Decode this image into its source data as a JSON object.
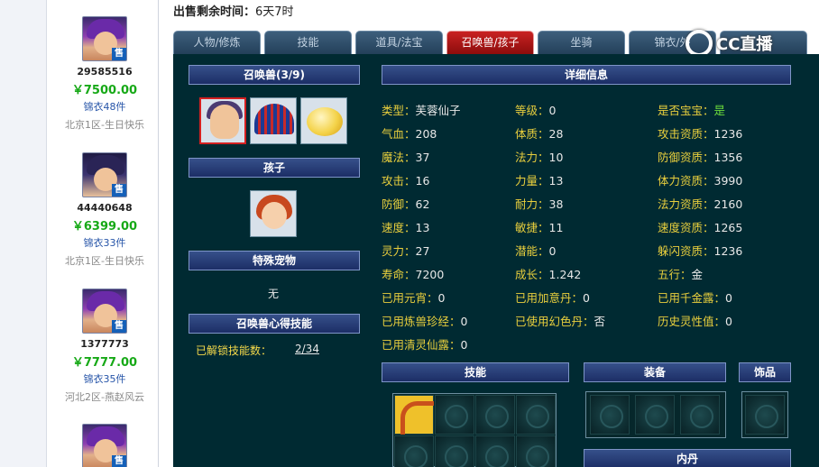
{
  "sidebar": {
    "listings": [
      {
        "id": "29585516",
        "price": "￥7500.00",
        "count": "锦衣48件",
        "server": "北京1区-生日快乐",
        "badge": "售"
      },
      {
        "id": "44440648",
        "price": "￥6399.00",
        "count": "锦衣33件",
        "server": "北京1区-生日快乐",
        "badge": "售"
      },
      {
        "id": "1377773",
        "price": "￥7777.00",
        "count": "锦衣35件",
        "server": "河北2区-燕赵风云",
        "badge": "售"
      },
      {
        "id": "",
        "price": "",
        "count": "",
        "server": "",
        "badge": "售"
      }
    ]
  },
  "header": {
    "countdown_label": "出售剩余时间：",
    "countdown_value": "6天7时"
  },
  "tabs": [
    {
      "label": "人物/修炼",
      "active": false
    },
    {
      "label": "技能",
      "active": false
    },
    {
      "label": "道具/法宝",
      "active": false
    },
    {
      "label": "召唤兽/孩子",
      "active": true
    },
    {
      "label": "坐骑",
      "active": false
    },
    {
      "label": "锦衣/外",
      "active": false
    },
    {
      "label": "",
      "active": false
    }
  ],
  "watermark": "CC直播",
  "left_panel": {
    "summon_title": "召唤兽(3/9)",
    "child_title": "孩子",
    "special_pet_title": "特殊宠物",
    "special_pet_value": "无",
    "skill_title": "召唤兽心得技能",
    "unlocked_label": "已解锁技能数：",
    "unlocked_value": "2/34"
  },
  "detail_title": "详细信息",
  "attributes": {
    "col1": [
      {
        "k": "类型：",
        "v": "芙蓉仙子"
      },
      {
        "k": "气血：",
        "v": "208"
      },
      {
        "k": "魔法：",
        "v": "37"
      },
      {
        "k": "攻击：",
        "v": "16"
      },
      {
        "k": "防御：",
        "v": "62"
      },
      {
        "k": "速度：",
        "v": "13"
      },
      {
        "k": "灵力：",
        "v": "27"
      },
      {
        "k": "寿命：",
        "v": "7200"
      },
      {
        "k": "已用元宵：",
        "v": "0"
      },
      {
        "k": "已用炼兽珍经：",
        "v": "0"
      },
      {
        "k": "已用清灵仙露：",
        "v": "0"
      }
    ],
    "col2": [
      {
        "k": "等级：",
        "v": "0"
      },
      {
        "k": "体质：",
        "v": "28"
      },
      {
        "k": "法力：",
        "v": "10"
      },
      {
        "k": "力量：",
        "v": "13"
      },
      {
        "k": "耐力：",
        "v": "38"
      },
      {
        "k": "敏捷：",
        "v": "11"
      },
      {
        "k": "潜能：",
        "v": "0"
      },
      {
        "k": "成长：",
        "v": "1.242"
      },
      {
        "k": "已用加意丹：",
        "v": "0"
      },
      {
        "k": "已使用幻色丹：",
        "v": "否"
      }
    ],
    "col3": [
      {
        "k": "是否宝宝：",
        "v": "是"
      },
      {
        "k": "攻击资质：",
        "v": "1236"
      },
      {
        "k": "防御资质：",
        "v": "1356"
      },
      {
        "k": "体力资质：",
        "v": "3990"
      },
      {
        "k": "法力资质：",
        "v": "2160"
      },
      {
        "k": "速度资质：",
        "v": "1265"
      },
      {
        "k": "躲闪资质：",
        "v": "1236"
      },
      {
        "k": "五行：",
        "v": "金"
      },
      {
        "k": "已用千金露：",
        "v": "0"
      },
      {
        "k": "历史灵性值：",
        "v": "0"
      }
    ]
  },
  "sections": {
    "skills": "技能",
    "equipment": "装备",
    "ornament": "饰品",
    "inner_pill": "内丹"
  }
}
